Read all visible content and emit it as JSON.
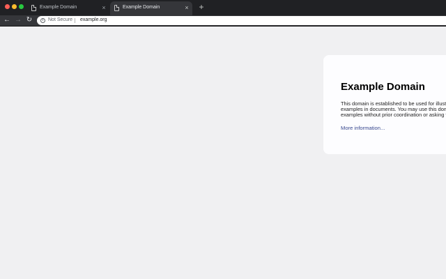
{
  "browser": {
    "tabs": [
      {
        "title": "Example Domain",
        "active": false
      },
      {
        "title": "Example Domain",
        "active": true
      }
    ],
    "close_tab_glyph": "×",
    "new_tab_glyph": "+",
    "nav": {
      "back_glyph": "←",
      "forward_glyph": "→",
      "reload_glyph": "↻"
    },
    "omnibox": {
      "info_glyph": "i",
      "security_label": "Not Secure",
      "url": "example.org"
    },
    "traffic_lights": {
      "close": "#ff5f57",
      "minimize": "#febc2e",
      "maximize": "#28c840"
    },
    "colors": {
      "tab_bar": "#202124",
      "toolbar": "#35363a"
    }
  },
  "page": {
    "heading": "Example Domain",
    "paragraph": "This domain is established to be used for illustrative examples in documents. You may use this domain in examples without prior coordination or asking for permission.",
    "link_text": "More information...",
    "colors": {
      "background": "#f0f0f2",
      "card": "#fdfdff",
      "link": "#38488f"
    }
  }
}
